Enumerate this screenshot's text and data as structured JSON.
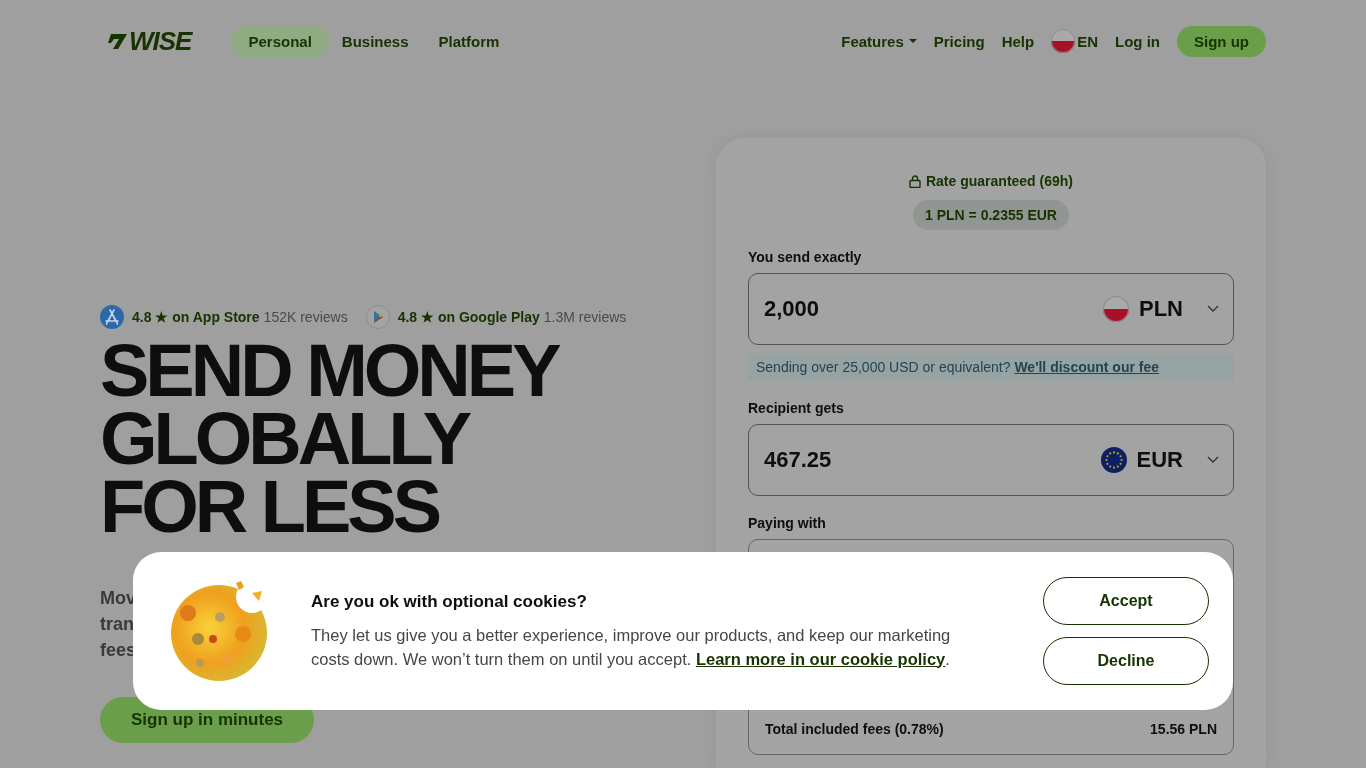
{
  "nav": {
    "logo": "WISE",
    "tabs": [
      {
        "label": "Personal",
        "selected": true
      },
      {
        "label": "Business",
        "selected": false
      },
      {
        "label": "Platform",
        "selected": false
      }
    ],
    "links": [
      {
        "label": "Features",
        "kind": "dropdown"
      },
      {
        "label": "Pricing",
        "kind": "link"
      },
      {
        "label": "Help",
        "kind": "link"
      },
      {
        "label": "EN",
        "kind": "language"
      },
      {
        "label": "Log in",
        "kind": "link"
      },
      {
        "label": "Sign up",
        "kind": "button"
      }
    ]
  },
  "hero": {
    "ratings": [
      {
        "kind": "app-store",
        "score": "4.8 ★ on App Store",
        "reviews": "152K reviews"
      },
      {
        "kind": "google-play",
        "score": "4.8 ★ on Google Play",
        "reviews": "1.3M reviews"
      }
    ],
    "headline": [
      "SEND MONEY",
      "GLOBALLY",
      "FOR LESS"
    ],
    "description_lines": [
      "Mov",
      "tran",
      "fees"
    ],
    "cta": "Sign up in minutes"
  },
  "calculator": {
    "rate_note": "Rate guaranteed (69h)",
    "rate": "1 PLN = 0.2355 EUR",
    "send": {
      "label": "You send exactly",
      "value": "2,000",
      "currency": "PLN"
    },
    "notice": {
      "text": "Sending over 25,000 USD or equivalent?",
      "link": "We'll discount our fee"
    },
    "receive": {
      "label": "Recipient gets",
      "value": "467.25",
      "currency": "EUR"
    },
    "paying_with": {
      "label": "Paying with"
    },
    "fees": {
      "label": "Total included fees (0.78%)",
      "value": "15.56 PLN"
    }
  },
  "cookie_banner": {
    "title": "Are you ok with optional cookies?",
    "body": "They let us give you a better experience, improve our products, and keep our marketing costs down. We won’t turn them on until you accept.",
    "link": "Learn more in our cookie policy",
    "after_link": ".",
    "buttons": [
      "Accept",
      "Decline"
    ]
  }
}
